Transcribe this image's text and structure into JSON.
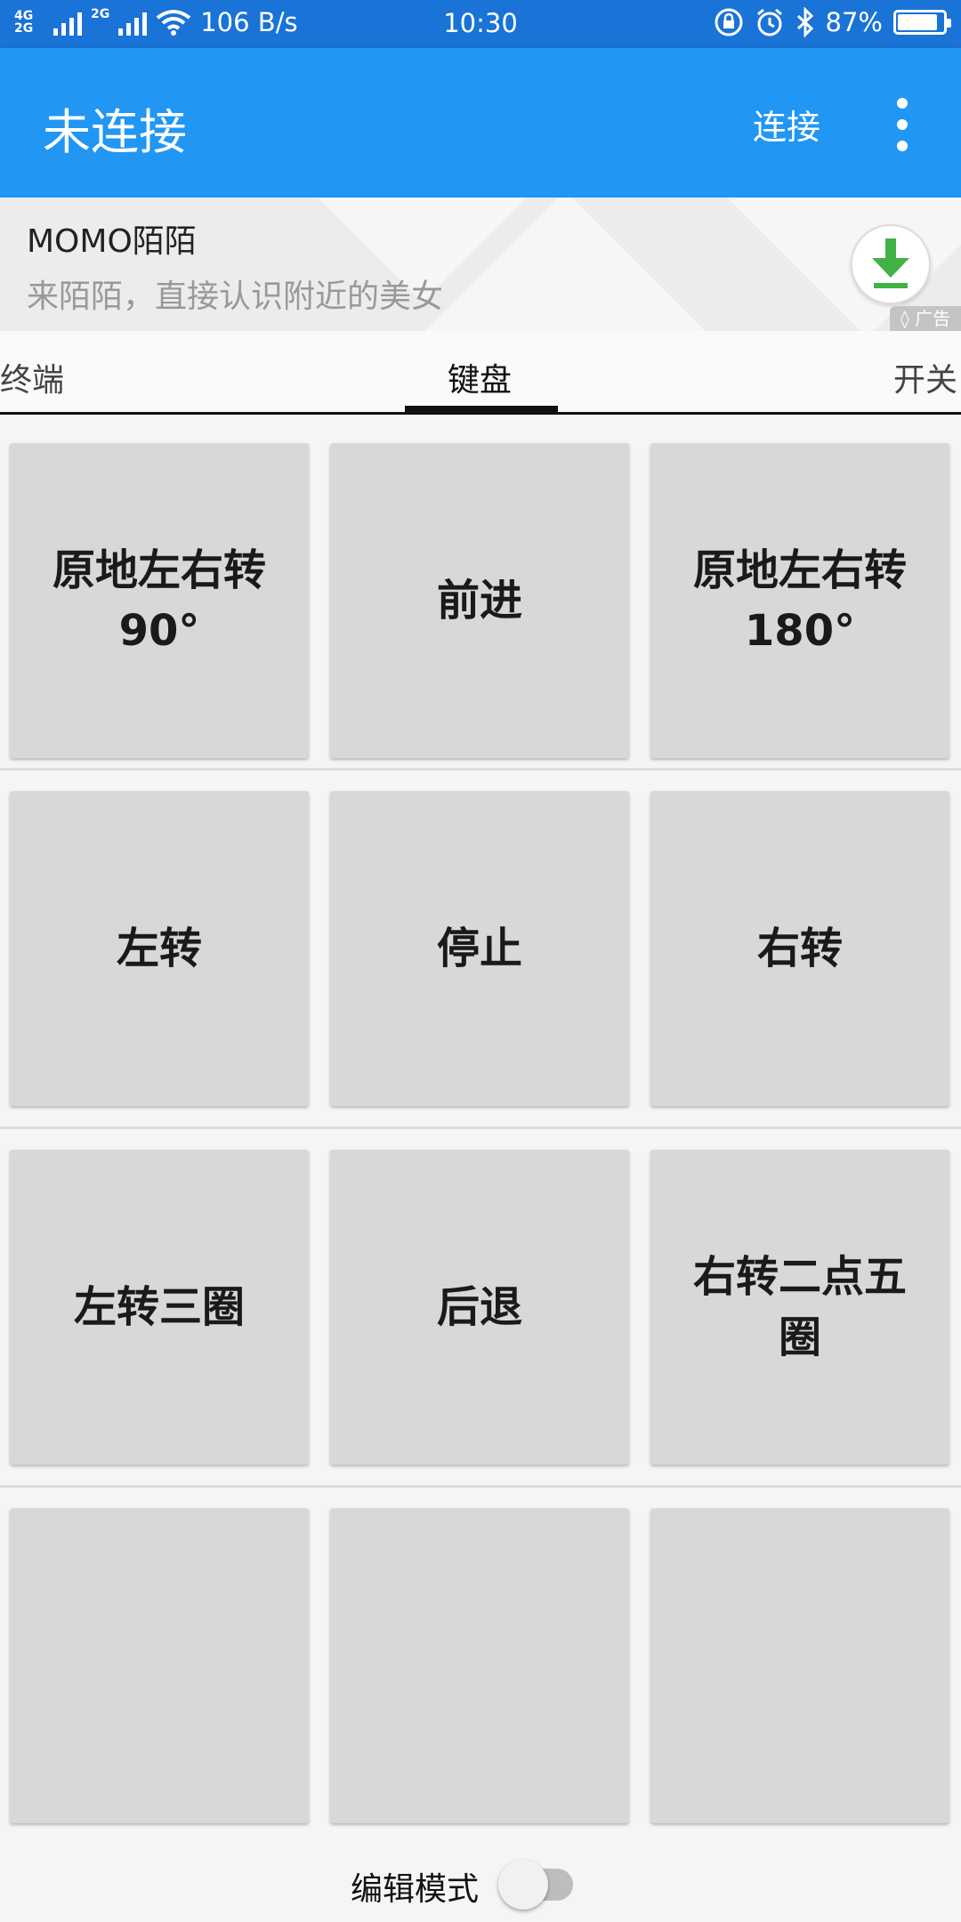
{
  "status_bar": {
    "network_label_1": "4G",
    "network_label_2": "2G",
    "network_label_3": "2G",
    "speed": "106 B/s",
    "time": "10:30",
    "battery": "87%",
    "battery_level": 0.87
  },
  "app_bar": {
    "title": "未连接",
    "connect_label": "连接",
    "menu_icon": "more-vert-icon"
  },
  "ad": {
    "name": "MOMO陌陌",
    "description": "来陌陌，直接认识附近的美女",
    "badge": "广告",
    "download_icon": "download-icon"
  },
  "tabs": [
    {
      "label": "终端",
      "active": false
    },
    {
      "label": "键盘",
      "active": true
    },
    {
      "label": "开关",
      "active": false
    }
  ],
  "keys": [
    [
      "原地左右转\n90°",
      "前进",
      "原地左右转\n180°"
    ],
    [
      "左转",
      "停止",
      "右转"
    ],
    [
      "左转三圈",
      "后退",
      "右转二点五\n圈"
    ],
    [
      "",
      "",
      ""
    ]
  ],
  "footer": {
    "edit_mode_label": "编辑模式",
    "edit_mode_on": false
  },
  "colors": {
    "status_bar": "#1a73d6",
    "app_bar": "#2196f3",
    "key_background": "#d7d8d8",
    "download_green": "#43b244"
  }
}
